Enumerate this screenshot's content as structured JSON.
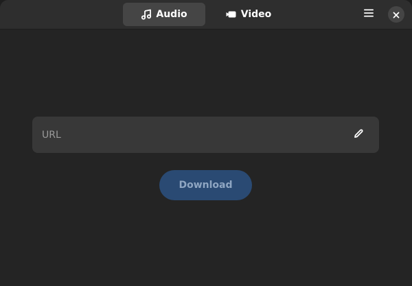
{
  "header": {
    "tabs": [
      {
        "label": "Audio",
        "icon": "music-note-icon",
        "active": true
      },
      {
        "label": "Video",
        "icon": "video-camera-icon",
        "active": false
      }
    ],
    "menu_icon": "hamburger-menu-icon",
    "close_icon": "close-icon"
  },
  "main": {
    "url_placeholder": "URL",
    "edit_icon": "pencil-icon",
    "download_label": "Download",
    "download_enabled": false
  },
  "colors": {
    "accent": "#2a4a73",
    "background": "#242424",
    "headerbar": "#2e2e2e",
    "entry": "#383838"
  }
}
